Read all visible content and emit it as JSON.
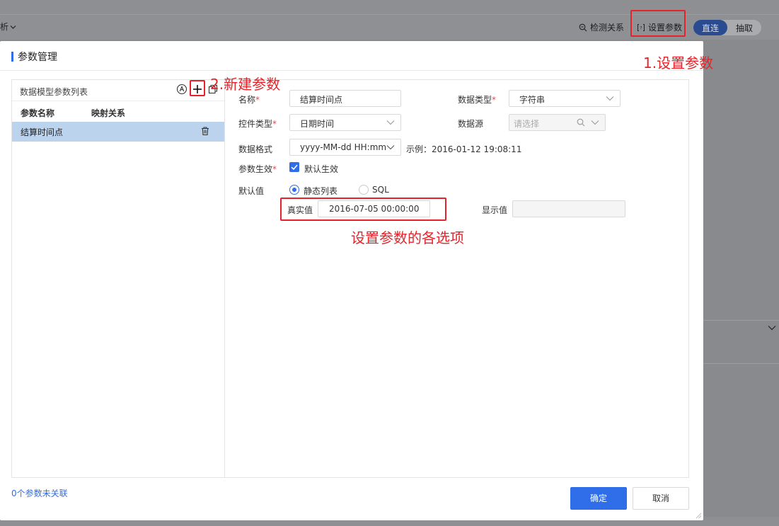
{
  "toolbar": {
    "left_fragment": "析",
    "detect_relation": "检测关系",
    "set_params": "设置参数",
    "mode_direct": "直连",
    "mode_extract": "抽取"
  },
  "dialog": {
    "title": "参数管理",
    "left_panel": {
      "title": "数据模型参数列表",
      "col_name": "参数名称",
      "col_mapping": "映射关系",
      "rows": [
        {
          "name": "结算时间点"
        }
      ]
    },
    "form": {
      "name_label": "名称",
      "name_value": "结算时间点",
      "data_type_label": "数据类型",
      "data_type_value": "字符串",
      "control_type_label": "控件类型",
      "control_type_value": "日期时间",
      "datasource_label": "数据源",
      "datasource_placeholder": "请选择",
      "format_label": "数据格式",
      "format_value": "yyyy-MM-dd HH:mm",
      "example": "示例：2016-01-12 19:08:11",
      "effective_label": "参数生效",
      "effective_checkbox": "默认生效",
      "effective_checked": true,
      "default_label": "默认值",
      "radio_static": "静态列表",
      "radio_sql": "SQL",
      "radio_selected": "静态列表",
      "real_value_label": "真实值",
      "real_value": "2016-07-05 00:00:00",
      "display_value_label": "显示值",
      "display_value": ""
    },
    "footer_note": "0个参数未关联",
    "ok": "确定",
    "cancel": "取消"
  },
  "annotations": {
    "step1": "1.设置参数",
    "step2": "2.新建参数",
    "options": "设置参数的各选项"
  },
  "colors": {
    "accent": "#2f6ee8",
    "annotation": "#e5232b",
    "selected_row": "#bcd3ee"
  }
}
